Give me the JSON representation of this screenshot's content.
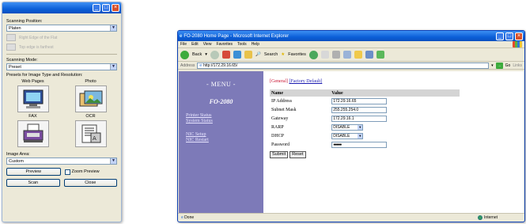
{
  "scanner": {
    "position_label": "Scanning Position:",
    "position_value": "Platen",
    "grey_opt1": "Right Edge of the Flat",
    "grey_opt2": "Top edge is farthest",
    "mode_label": "Scanning Mode:",
    "mode_value": "Preset",
    "presets_label": "Presets for Image Type and Resolution:",
    "presets": [
      "Web Pages",
      "Photo",
      "FAX",
      "OCR"
    ],
    "area_label": "Image Area:",
    "area_value": "Custom",
    "preview_btn": "Preview",
    "zoom_preview": "Zoom Preview",
    "scan_btn": "Scan",
    "close_btn": "Close"
  },
  "browser": {
    "title": "FO-2080 Home Page - Microsoft Internet Explorer",
    "menu": [
      "File",
      "Edit",
      "View",
      "Favorites",
      "Tools",
      "Help"
    ],
    "back": "Back",
    "search": "Search",
    "favorites": "Favorites",
    "address_label": "Address",
    "address_value": "http://172.29.16.65/",
    "go": "Go",
    "links": "Links",
    "status_left": "Done",
    "status_zone": "Internet"
  },
  "nav": {
    "menu_heading": "- MENU -",
    "model": "FO-2080",
    "printer_status": "Printer Status",
    "system_status": "System Status",
    "nic_setup": "NIC Setup",
    "nic_restart": "NIC Restart"
  },
  "page": {
    "tab_general": "[General]",
    "tab_factory": "[Factory Default]",
    "col_name": "Name",
    "col_value": "Value",
    "rows": [
      {
        "name": "IP Address",
        "value": "172.29.16.65"
      },
      {
        "name": "Subnet Mask",
        "value": "255.255.254.0"
      },
      {
        "name": "Gateway",
        "value": "172.29.16.1"
      },
      {
        "name": "RARP",
        "value": "DISABLE"
      },
      {
        "name": "DHCP",
        "value": "DISABLE"
      },
      {
        "name": "Password",
        "value": "●●●●●"
      }
    ],
    "submit": "Submit",
    "reset": "Reset"
  }
}
